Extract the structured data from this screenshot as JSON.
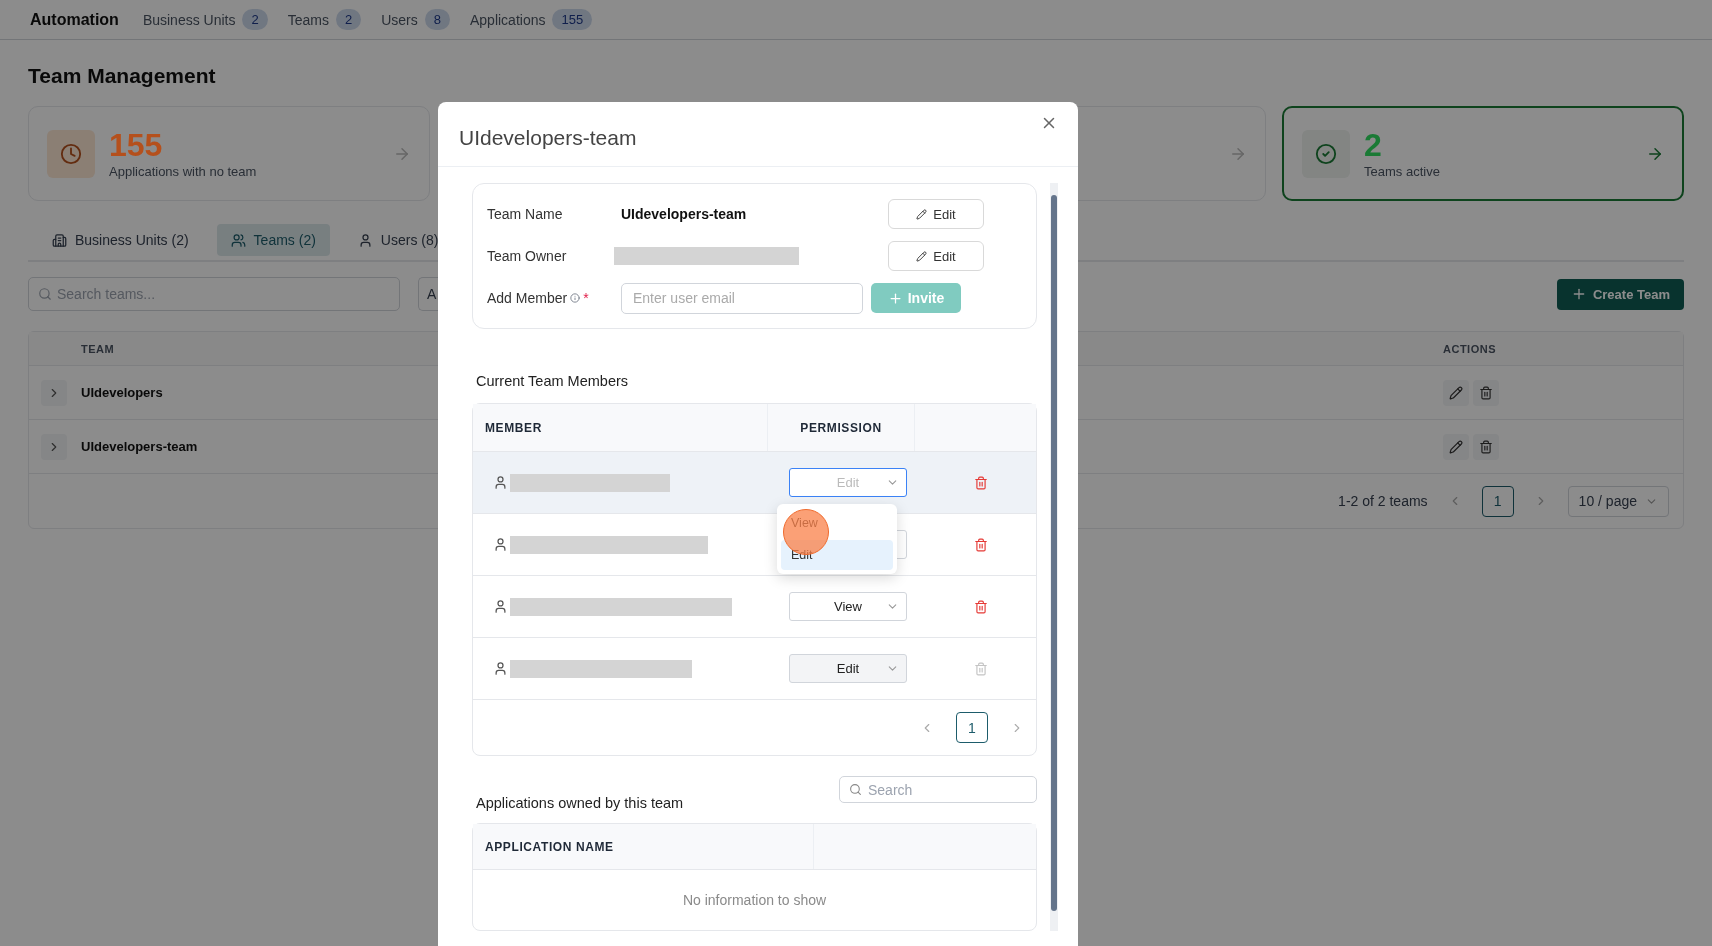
{
  "nav": {
    "brand": "Automation",
    "items": [
      {
        "label": "Business Units",
        "count": "2"
      },
      {
        "label": "Teams",
        "count": "2"
      },
      {
        "label": "Users",
        "count": "8"
      },
      {
        "label": "Applications",
        "count": "155"
      }
    ]
  },
  "page_title": "Team Management",
  "stats": [
    {
      "kind": "no_team",
      "value": "155",
      "label": "Applications with no team",
      "color": "#b5501c",
      "highlighted": false
    },
    {
      "kind": "covered"
    },
    {
      "kind": "active",
      "value": "2",
      "label": "Teams active",
      "color": "#1a7a35",
      "highlighted": true
    }
  ],
  "tabs": [
    {
      "kind": "units",
      "label": "Business Units (2)",
      "selected": false
    },
    {
      "kind": "teams",
      "label": "Teams (2)",
      "selected": true
    },
    {
      "kind": "users",
      "label": "Users (8)",
      "selected": false
    }
  ],
  "search": {
    "placeholder": "Search teams..."
  },
  "filter": {
    "value": "A"
  },
  "create_button": "Create Team",
  "teams_table": {
    "columns": [
      "TEAM",
      "ACTIONS"
    ],
    "rows": [
      {
        "name": "UIdevelopers"
      },
      {
        "name": "UIdevelopers-team"
      }
    ],
    "range": "1-2 of 2 teams",
    "page": "1",
    "page_size": "10 / page"
  },
  "modal": {
    "title": "UIdevelopers-team",
    "details": {
      "name_label": "Team Name",
      "name_value": "UIdevelopers-team",
      "name_edit": "Edit",
      "owner_label": "Team Owner",
      "owner_edit": "Edit",
      "add_label": "Add Member",
      "required": "*",
      "email_placeholder": "Enter user email",
      "invite": "Invite"
    },
    "members": {
      "heading": "Current Team Members",
      "columns": [
        "MEMBER",
        "PERMISSION"
      ],
      "rows": [
        {
          "permission": "Edit",
          "selected": true,
          "disabled": false
        },
        {
          "selected": false,
          "disabled": false
        },
        {
          "permission": "View",
          "selected": false,
          "disabled": false
        },
        {
          "permission": "Edit",
          "selected": false,
          "disabled": true
        }
      ],
      "dropdown": {
        "options": [
          {
            "label": "View",
            "selected": false
          },
          {
            "label": "Edit",
            "selected": true
          }
        ]
      },
      "page": "1"
    },
    "apps": {
      "heading": "Applications owned by this team",
      "search_placeholder": "Search",
      "columns": [
        "APPLICATION NAME"
      ],
      "empty": "No information to show"
    }
  }
}
